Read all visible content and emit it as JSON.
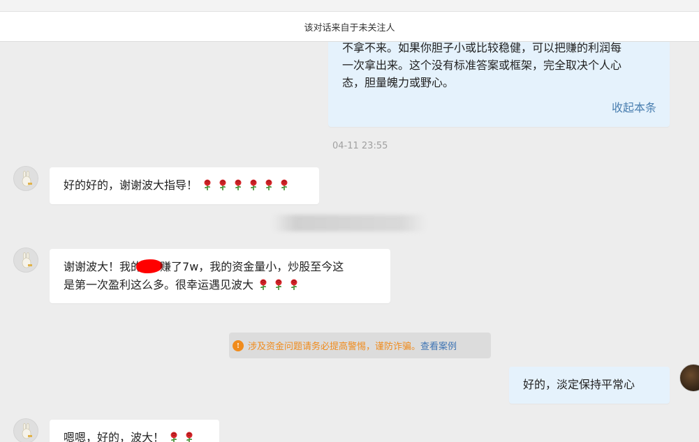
{
  "header": {
    "notice": "该对话来自于未关注人"
  },
  "quoted_message": {
    "lines": [
      "不拿不来。如果你胆子小或比较稳健，可以把赚的利润每",
      "一次拿出来。这个没有标准答案或框架，完全取决个人心",
      "态，胆量魄力或野心。"
    ],
    "collapse_label": "收起本条"
  },
  "timestamp": "04-11 23:55",
  "messages": [
    {
      "text": "好的好的，谢谢波大指导！",
      "roses": 6
    },
    {
      "part1": "谢谢波大！我的",
      "part2": "赚了7w，我的资金量小，炒股至今这",
      "line2": "是第一次盈利这么多。很幸运遇见波大",
      "roses": 3
    },
    {
      "text": "好的，淡定保持平常心"
    },
    {
      "text": "嗯嗯，好的，波大！",
      "roses": 2
    }
  ],
  "warning": {
    "text": "涉及资金问题请务必提高警惕，谨防诈骗。",
    "link": "查看案例"
  },
  "colors": {
    "background": "#ededed",
    "self_bubble": "#e5f2fc",
    "warning_orange": "#f08b1c",
    "link_blue": "#3d73b3"
  }
}
